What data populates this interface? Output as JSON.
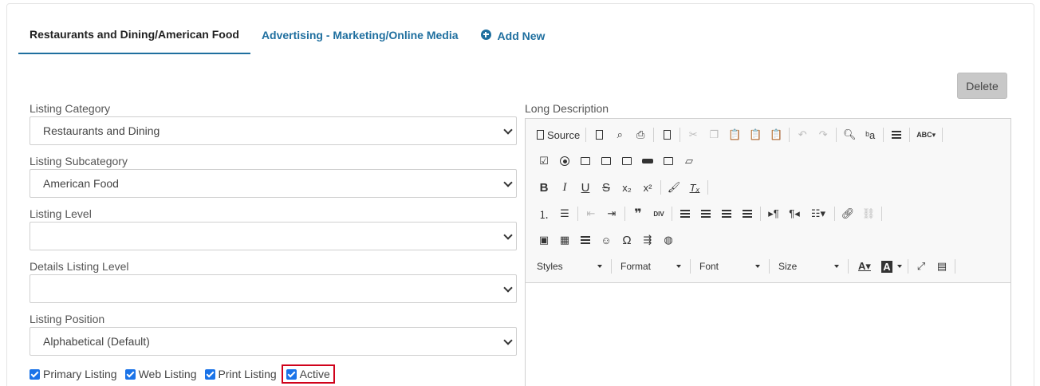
{
  "tabs": [
    {
      "label": "Restaurants and Dining/American Food",
      "active": true
    },
    {
      "label": "Advertising - Marketing/Online Media",
      "active": false
    }
  ],
  "add_new_label": "Add New",
  "delete_label": "Delete",
  "fields": {
    "category": {
      "label": "Listing Category",
      "value": "Restaurants and Dining"
    },
    "subcategory": {
      "label": "Listing Subcategory",
      "value": "American Food"
    },
    "level": {
      "label": "Listing Level",
      "value": ""
    },
    "details_level": {
      "label": "Details Listing Level",
      "value": ""
    },
    "position": {
      "label": "Listing Position",
      "value": "Alphabetical (Default)"
    }
  },
  "checkboxes": [
    {
      "label": "Primary Listing",
      "checked": true
    },
    {
      "label": "Web Listing",
      "checked": true
    },
    {
      "label": "Print Listing",
      "checked": true
    },
    {
      "label": "Active",
      "checked": true
    }
  ],
  "editor": {
    "label": "Long Description",
    "source_label": "Source",
    "styles_label": "Styles",
    "format_label": "Format",
    "font_label": "Font",
    "size_label": "Size"
  },
  "colors": {
    "accent": "#1f6f9f",
    "checkbox": "#1a73e8",
    "highlight": "#d0021b"
  }
}
